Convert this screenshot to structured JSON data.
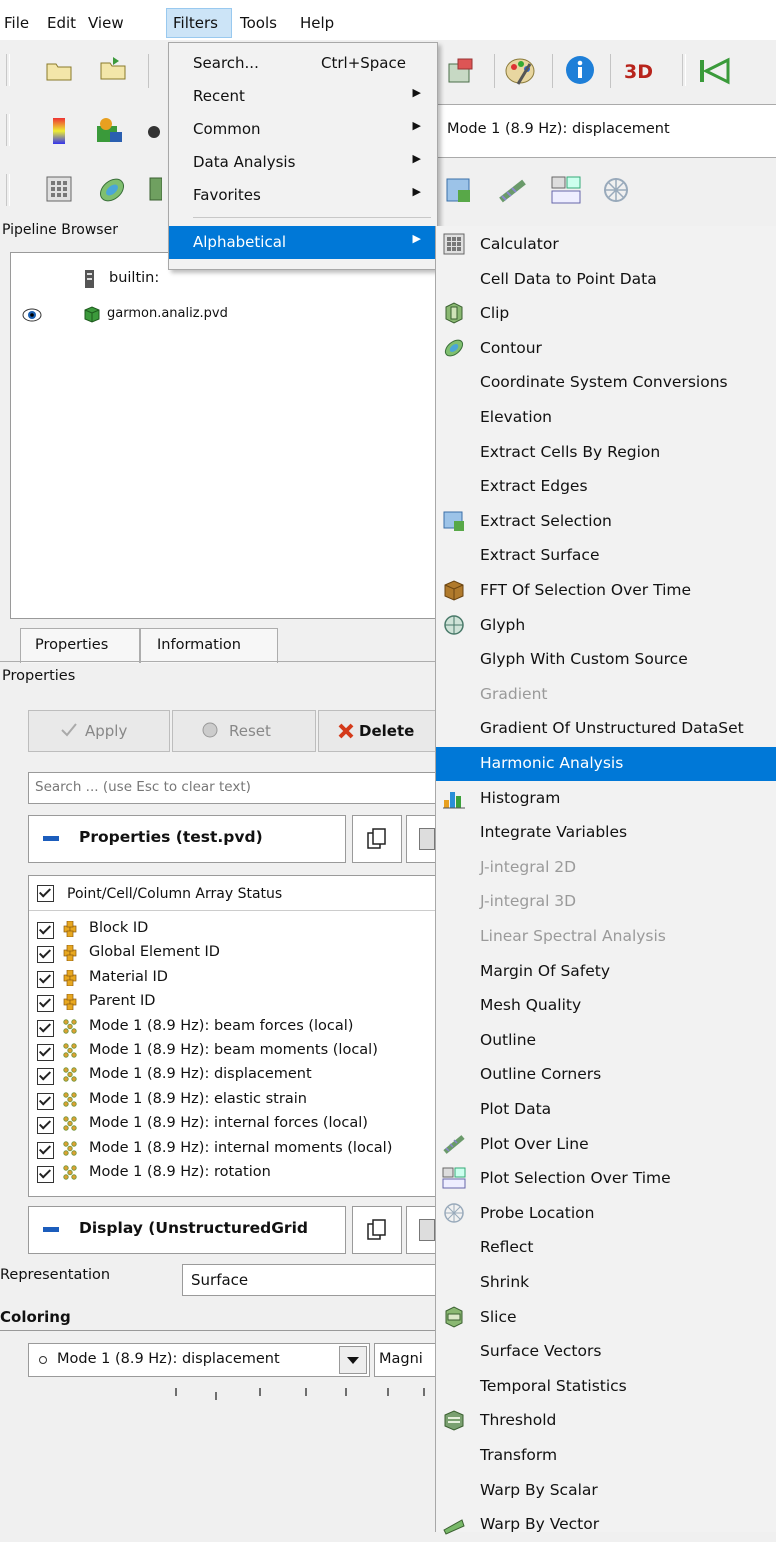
{
  "menubar": {
    "items": [
      "File",
      "Edit",
      "View",
      "Filters",
      "Tools",
      "Help"
    ]
  },
  "toolbar": {
    "mode_field": "Mode 1 (8.9 Hz): displacement"
  },
  "filters_menu": {
    "items": [
      {
        "label": "Search...",
        "shortcut": "Ctrl+Space",
        "submenu": false
      },
      {
        "label": "Recent",
        "shortcut": "",
        "submenu": true
      },
      {
        "label": "Common",
        "shortcut": "",
        "submenu": true
      },
      {
        "label": "Data Analysis",
        "shortcut": "",
        "submenu": true
      },
      {
        "label": "Favorites",
        "shortcut": "",
        "submenu": true
      },
      {
        "label": "Alphabetical",
        "shortcut": "",
        "submenu": true,
        "selected": true
      }
    ]
  },
  "alphabetical_menu": {
    "items": [
      {
        "label": "Calculator",
        "icon": "calculator-icon"
      },
      {
        "label": "Cell Data to Point Data",
        "icon": ""
      },
      {
        "label": "Clip",
        "icon": "clip-icon"
      },
      {
        "label": "Contour",
        "icon": "contour-icon"
      },
      {
        "label": "Coordinate System Conversions",
        "icon": ""
      },
      {
        "label": "Elevation",
        "icon": ""
      },
      {
        "label": "Extract Cells By Region",
        "icon": ""
      },
      {
        "label": "Extract Edges",
        "icon": ""
      },
      {
        "label": "Extract Selection",
        "icon": "extract-selection-icon"
      },
      {
        "label": "Extract Surface",
        "icon": ""
      },
      {
        "label": "FFT Of Selection Over Time",
        "icon": "fft-icon"
      },
      {
        "label": "Glyph",
        "icon": "glyph-icon"
      },
      {
        "label": "Glyph With Custom Source",
        "icon": ""
      },
      {
        "label": "Gradient",
        "icon": "",
        "disabled": true
      },
      {
        "label": "Gradient Of Unstructured DataSet",
        "icon": ""
      },
      {
        "label": "Harmonic Analysis",
        "icon": "",
        "highlighted": true
      },
      {
        "label": "Histogram",
        "icon": "histogram-icon"
      },
      {
        "label": "Integrate Variables",
        "icon": ""
      },
      {
        "label": "J-integral 2D",
        "icon": "",
        "disabled": true
      },
      {
        "label": "J-integral 3D",
        "icon": "",
        "disabled": true
      },
      {
        "label": "Linear Spectral Analysis",
        "icon": "",
        "disabled": true
      },
      {
        "label": "Margin Of Safety",
        "icon": ""
      },
      {
        "label": "Mesh Quality",
        "icon": ""
      },
      {
        "label": "Outline",
        "icon": ""
      },
      {
        "label": "Outline Corners",
        "icon": ""
      },
      {
        "label": "Plot Data",
        "icon": ""
      },
      {
        "label": "Plot Over Line",
        "icon": "plot-over-line-icon"
      },
      {
        "label": "Plot Selection Over Time",
        "icon": "plot-selection-icon"
      },
      {
        "label": "Probe Location",
        "icon": "probe-icon"
      },
      {
        "label": "Reflect",
        "icon": ""
      },
      {
        "label": "Shrink",
        "icon": ""
      },
      {
        "label": "Slice",
        "icon": "slice-icon"
      },
      {
        "label": "Surface Vectors",
        "icon": ""
      },
      {
        "label": "Temporal Statistics",
        "icon": ""
      },
      {
        "label": "Threshold",
        "icon": "threshold-icon"
      },
      {
        "label": "Transform",
        "icon": ""
      },
      {
        "label": "Warp By Scalar",
        "icon": ""
      },
      {
        "label": "Warp By Vector",
        "icon": "warp-vector-icon"
      }
    ]
  },
  "pipeline": {
    "title": "Pipeline Browser",
    "items": [
      "builtin:",
      "garmon.analiz.pvd"
    ]
  },
  "properties": {
    "tabs": [
      "Properties",
      "Information"
    ],
    "header": "Properties",
    "apply": "Apply",
    "reset": "Reset",
    "delete": "Delete",
    "search_placeholder": "Search ... (use Esc to clear text)",
    "section_title": "Properties (test.pvd)",
    "array_header": "Point/Cell/Column Array Status",
    "arrays": [
      {
        "label": "Block ID",
        "kind": "cell"
      },
      {
        "label": "Global Element ID",
        "kind": "cell"
      },
      {
        "label": "Material ID",
        "kind": "cell"
      },
      {
        "label": "Parent ID",
        "kind": "cell"
      },
      {
        "label": "Mode 1 (8.9 Hz): beam forces (local)",
        "kind": "point"
      },
      {
        "label": "Mode 1 (8.9 Hz): beam moments (local)",
        "kind": "point"
      },
      {
        "label": "Mode 1 (8.9 Hz): displacement",
        "kind": "point"
      },
      {
        "label": "Mode 1 (8.9 Hz): elastic strain",
        "kind": "point"
      },
      {
        "label": "Mode 1 (8.9 Hz): internal forces (local)",
        "kind": "point"
      },
      {
        "label": "Mode 1 (8.9 Hz): internal moments (local)",
        "kind": "point"
      },
      {
        "label": "Mode 1 (8.9 Hz): rotation",
        "kind": "point"
      }
    ],
    "display_title": "Display (UnstructuredGrid",
    "representation_label": "Representation",
    "representation_value": "Surface",
    "coloring_label": "Coloring",
    "coloring_value": "Mode 1 (8.9 Hz): displacement",
    "coloring_component": "Magni"
  },
  "colors": {
    "highlight": "#0078d7",
    "menu_bg": "#f2f2f2"
  }
}
